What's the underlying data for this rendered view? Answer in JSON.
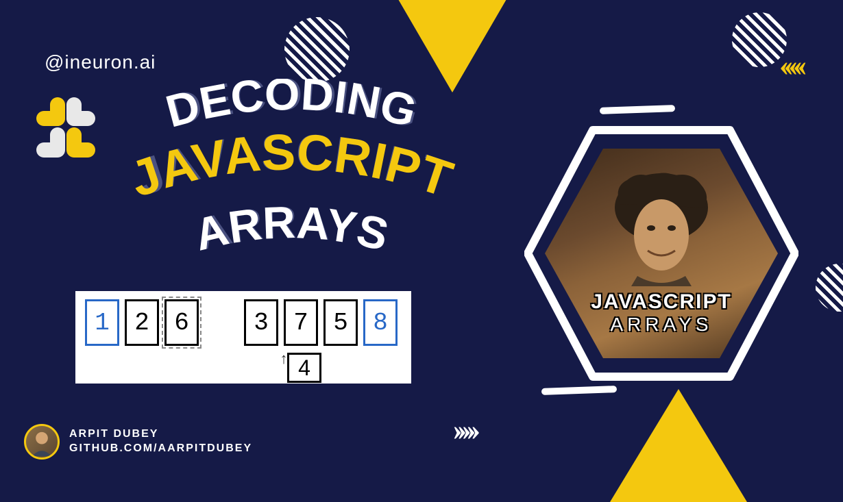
{
  "handle": "@ineuron.ai",
  "title": {
    "line1": "DECODING",
    "line2": "JAVASCRIPT",
    "line3": "ARRAYS"
  },
  "array_diagram": {
    "cells": [
      "1",
      "2",
      "6",
      "",
      "3",
      "7",
      "5",
      "8"
    ],
    "pointer_value": "4"
  },
  "meme": {
    "line1": "JAVASCRIPT",
    "line2": "ARRAYS"
  },
  "author": {
    "name": "ARPIT DUBEY",
    "link": "GITHUB.COM/AARPITDUBEY"
  },
  "chevrons_left": "‹‹‹‹‹",
  "chevrons_right": "›››››"
}
